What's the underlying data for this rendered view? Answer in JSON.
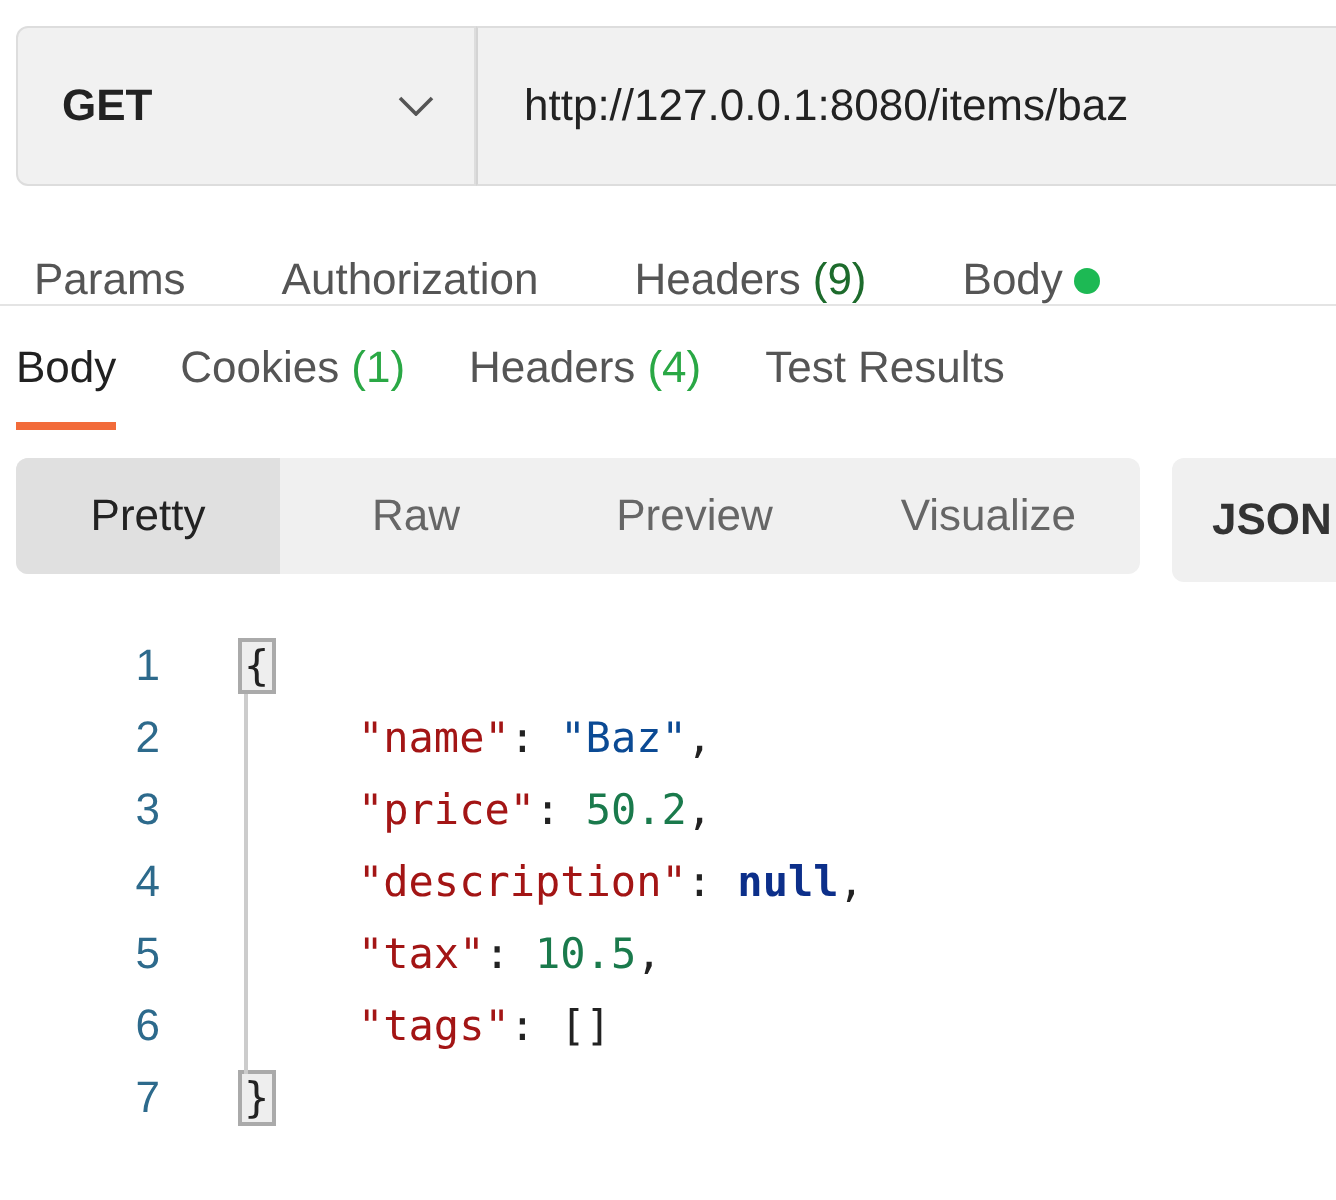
{
  "request": {
    "method": "GET",
    "url": "http://127.0.0.1:8080/items/baz"
  },
  "request_tabs": [
    {
      "label": "Params",
      "modified": false
    },
    {
      "label": "Authorization",
      "modified": false
    },
    {
      "label": "Headers",
      "count": "(9)",
      "modified": false
    },
    {
      "label": "Body",
      "modified": true
    }
  ],
  "response_tabs": [
    {
      "label": "Body",
      "selected": true
    },
    {
      "label": "Cookies",
      "count": "(1)",
      "selected": false
    },
    {
      "label": "Headers",
      "count": "(4)",
      "selected": false
    },
    {
      "label": "Test Results",
      "selected": false
    }
  ],
  "view_modes": [
    {
      "label": "Pretty",
      "selected": true
    },
    {
      "label": "Raw",
      "selected": false
    },
    {
      "label": "Preview",
      "selected": false
    },
    {
      "label": "Visualize",
      "selected": false
    }
  ],
  "format": "JSON",
  "code_lines": [
    {
      "number": "1",
      "indented": false,
      "tokens": [
        {
          "kind": "brace",
          "text": "{"
        }
      ]
    },
    {
      "number": "2",
      "indented": true,
      "tokens": [
        {
          "kind": "key",
          "text": "\"name\""
        },
        {
          "kind": "punct",
          "text": ": "
        },
        {
          "kind": "string",
          "text": "\"Baz\""
        },
        {
          "kind": "punct",
          "text": ","
        }
      ]
    },
    {
      "number": "3",
      "indented": true,
      "tokens": [
        {
          "kind": "key",
          "text": "\"price\""
        },
        {
          "kind": "punct",
          "text": ": "
        },
        {
          "kind": "number",
          "text": "50.2"
        },
        {
          "kind": "punct",
          "text": ","
        }
      ]
    },
    {
      "number": "4",
      "indented": true,
      "tokens": [
        {
          "kind": "key",
          "text": "\"description\""
        },
        {
          "kind": "punct",
          "text": ": "
        },
        {
          "kind": "keyword",
          "text": "null"
        },
        {
          "kind": "punct",
          "text": ","
        }
      ]
    },
    {
      "number": "5",
      "indented": true,
      "tokens": [
        {
          "kind": "key",
          "text": "\"tax\""
        },
        {
          "kind": "punct",
          "text": ": "
        },
        {
          "kind": "number",
          "text": "10.5"
        },
        {
          "kind": "punct",
          "text": ","
        }
      ]
    },
    {
      "number": "6",
      "indented": true,
      "tokens": [
        {
          "kind": "key",
          "text": "\"tags\""
        },
        {
          "kind": "punct",
          "text": ": "
        },
        {
          "kind": "punct",
          "text": "[]"
        }
      ]
    },
    {
      "number": "7",
      "indented": false,
      "tokens": [
        {
          "kind": "brace",
          "text": "}"
        }
      ]
    }
  ]
}
